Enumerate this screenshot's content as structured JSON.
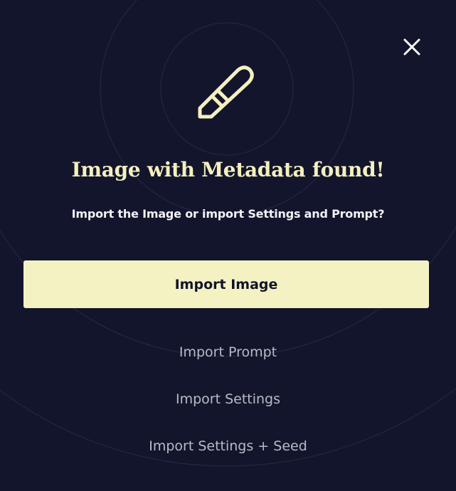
{
  "dialog": {
    "title": "Image with Metadata found!",
    "subtitle": "Import the Image or import Settings and Prompt?",
    "primary_button": "Import Image",
    "options": [
      "Import Prompt",
      "Import Settings",
      "Import Settings + Seed"
    ]
  },
  "icons": {
    "close": "close-icon",
    "hero": "pen-icon"
  },
  "colors": {
    "background": "#13152c",
    "accent": "#f4f2c3",
    "title": "#f4f0bf",
    "option_text": "#b9bac8"
  }
}
